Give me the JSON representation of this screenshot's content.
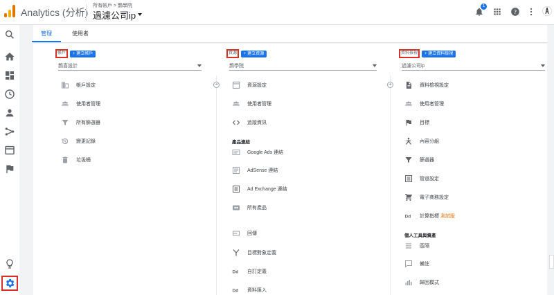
{
  "app": {
    "title": "Analytics (分析)"
  },
  "header": {
    "breadcrumb": "所有帳戶 > 鵲學院",
    "view_title": "過濾公司ip",
    "notification_count": "1",
    "icons": [
      "bell-icon",
      "apps-icon",
      "help-icon",
      "more-vert-icon",
      "account-avatar"
    ]
  },
  "sidenav": {
    "items": [
      "search-icon",
      "home-icon",
      "dashboard-icon",
      "clock-icon",
      "person-icon",
      "acquisition-icon",
      "behavior-icon",
      "flag-icon",
      "lightbulb-icon",
      "settings-icon"
    ]
  },
  "tabs": [
    {
      "label": "管理"
    },
    {
      "label": "使用者"
    }
  ],
  "columns": {
    "account": {
      "label": "帳戶",
      "create_label": "建立帳戶",
      "selected": "鵲喜設計",
      "items": [
        {
          "icon": "building-icon",
          "label": "帳戶設定"
        },
        {
          "icon": "people-icon",
          "label": "使用者管理"
        },
        {
          "icon": "filter-icon",
          "label": "所有篩選器"
        },
        {
          "icon": "history-icon",
          "label": "變更記錄"
        },
        {
          "icon": "trash-icon",
          "label": "垃圾桶"
        }
      ]
    },
    "property": {
      "label": "資源",
      "create_label": "建立資源",
      "selected": "鵲學院",
      "items": [
        {
          "icon": "property-settings-icon",
          "label": "資源設定"
        },
        {
          "icon": "people-icon",
          "label": "使用者管理"
        },
        {
          "icon": "code-icon",
          "label": "追蹤資訊"
        }
      ],
      "section_label": "產品連結",
      "linked_items": [
        {
          "icon": "google-ads-icon",
          "label": "Google Ads 連結"
        },
        {
          "icon": "adsense-icon",
          "label": "AdSense 連結"
        },
        {
          "icon": "ad-exchange-icon",
          "label": "Ad Exchange 連結"
        },
        {
          "icon": "all-products-icon",
          "label": "所有產品"
        }
      ],
      "more_items": [
        {
          "icon": "postback-icon",
          "label": "回傳"
        },
        {
          "icon": "audience-icon",
          "label": "目標對象定義"
        },
        {
          "icon": "dd-icon",
          "label": "自訂定義"
        },
        {
          "icon": "dd-icon",
          "label": "資料匯入"
        }
      ]
    },
    "view": {
      "label": "資料檢視",
      "create_label": "建立資料檢視",
      "selected": "過濾公司ip",
      "items": [
        {
          "icon": "document-icon",
          "label": "資料檢視設定"
        },
        {
          "icon": "people-icon",
          "label": "使用者管理"
        },
        {
          "icon": "flag-icon",
          "label": "目標"
        },
        {
          "icon": "content-grouping-icon",
          "label": "內容分組"
        },
        {
          "icon": "filter-icon",
          "label": "篩選器"
        },
        {
          "icon": "channel-settings-icon",
          "label": "管道設定"
        },
        {
          "icon": "cart-icon",
          "label": "電子商務設定"
        }
      ],
      "calc_item": {
        "icon": "dd-icon",
        "label": "計算指標",
        "badge": "測試版"
      },
      "section_label": "個人工具與資產",
      "personal_items": [
        {
          "icon": "segments-icon",
          "label": "區隔"
        },
        {
          "icon": "annotation-icon",
          "label": "備註"
        },
        {
          "icon": "attribution-icon",
          "label": "歸因模式"
        }
      ]
    }
  },
  "colors": {
    "accent": "#1a73e8",
    "highlight_border": "#d93025",
    "beta": "#e8710a"
  }
}
